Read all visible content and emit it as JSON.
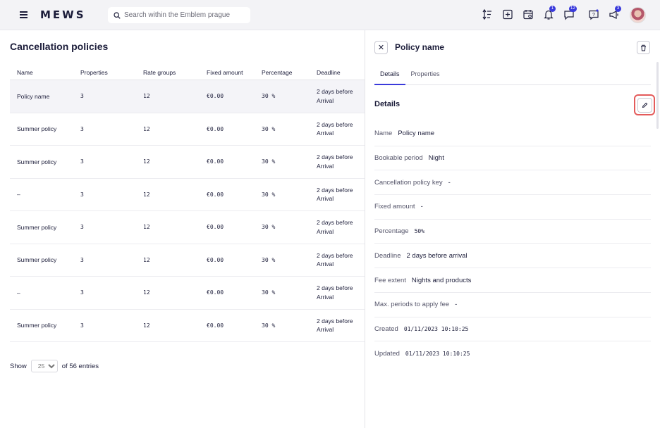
{
  "header": {
    "logo": "MEWS",
    "search_placeholder": "Search within the Emblem prague",
    "notifications_badge": "1",
    "messages_badge": "12",
    "announcements_badge": "3"
  },
  "main": {
    "title": "Cancellation policies",
    "columns": [
      "Name",
      "Properties",
      "Rate groups",
      "Fixed amount",
      "Percentage",
      "Deadline"
    ],
    "rows": [
      {
        "name": "Policy name",
        "properties": "3",
        "rate_groups": "12",
        "fixed_amount": "€0.00",
        "percentage": "30 %",
        "deadline_1": "2 days before",
        "deadline_2": "Arrival"
      },
      {
        "name": "Summer policy",
        "properties": "3",
        "rate_groups": "12",
        "fixed_amount": "€0.00",
        "percentage": "30 %",
        "deadline_1": "2 days before",
        "deadline_2": "Arrival"
      },
      {
        "name": "Summer policy",
        "properties": "3",
        "rate_groups": "12",
        "fixed_amount": "€0.00",
        "percentage": "30 %",
        "deadline_1": "2 days before",
        "deadline_2": "Arrival"
      },
      {
        "name": "–",
        "properties": "3",
        "rate_groups": "12",
        "fixed_amount": "€0.00",
        "percentage": "30 %",
        "deadline_1": "2 days before",
        "deadline_2": "Arrival"
      },
      {
        "name": "Summer policy",
        "properties": "3",
        "rate_groups": "12",
        "fixed_amount": "€0.00",
        "percentage": "30 %",
        "deadline_1": "2 days before",
        "deadline_2": "Arrival"
      },
      {
        "name": "Summer policy",
        "properties": "3",
        "rate_groups": "12",
        "fixed_amount": "€0.00",
        "percentage": "30 %",
        "deadline_1": "2 days before",
        "deadline_2": "Arrival"
      },
      {
        "name": "–",
        "properties": "3",
        "rate_groups": "12",
        "fixed_amount": "€0.00",
        "percentage": "30 %",
        "deadline_1": "2 days before",
        "deadline_2": "Arrival"
      },
      {
        "name": "Summer policy",
        "properties": "3",
        "rate_groups": "12",
        "fixed_amount": "€0.00",
        "percentage": "30 %",
        "deadline_1": "2 days before",
        "deadline_2": "Arrival"
      }
    ],
    "pager": {
      "show_label": "Show",
      "page_size": "25",
      "entries_text": "of 56 entries"
    }
  },
  "panel": {
    "title": "Policy name",
    "tabs": [
      "Details",
      "Properties"
    ],
    "section_title": "Details",
    "fields": [
      {
        "label": "Name",
        "value": "Policy name"
      },
      {
        "label": "Bookable period",
        "value": "Night"
      },
      {
        "label": "Cancellation policy key",
        "value": "-"
      },
      {
        "label": "Fixed amount",
        "value": "-"
      },
      {
        "label": "Percentage",
        "value": "50%"
      },
      {
        "label": "Deadline",
        "value": "2 days before arrival"
      },
      {
        "label": "Fee extent",
        "value": "Nights and products"
      },
      {
        "label": "Max. periods to apply fee",
        "value": "-"
      },
      {
        "label": "Created",
        "value": "01/11/2023 10:10:25"
      },
      {
        "label": "Updated",
        "value": "01/11/2023 10:10:25"
      }
    ]
  },
  "colors": {
    "accent": "#3a3adb",
    "highlight": "#e45b5b",
    "topbar": "#f3f3f6"
  }
}
